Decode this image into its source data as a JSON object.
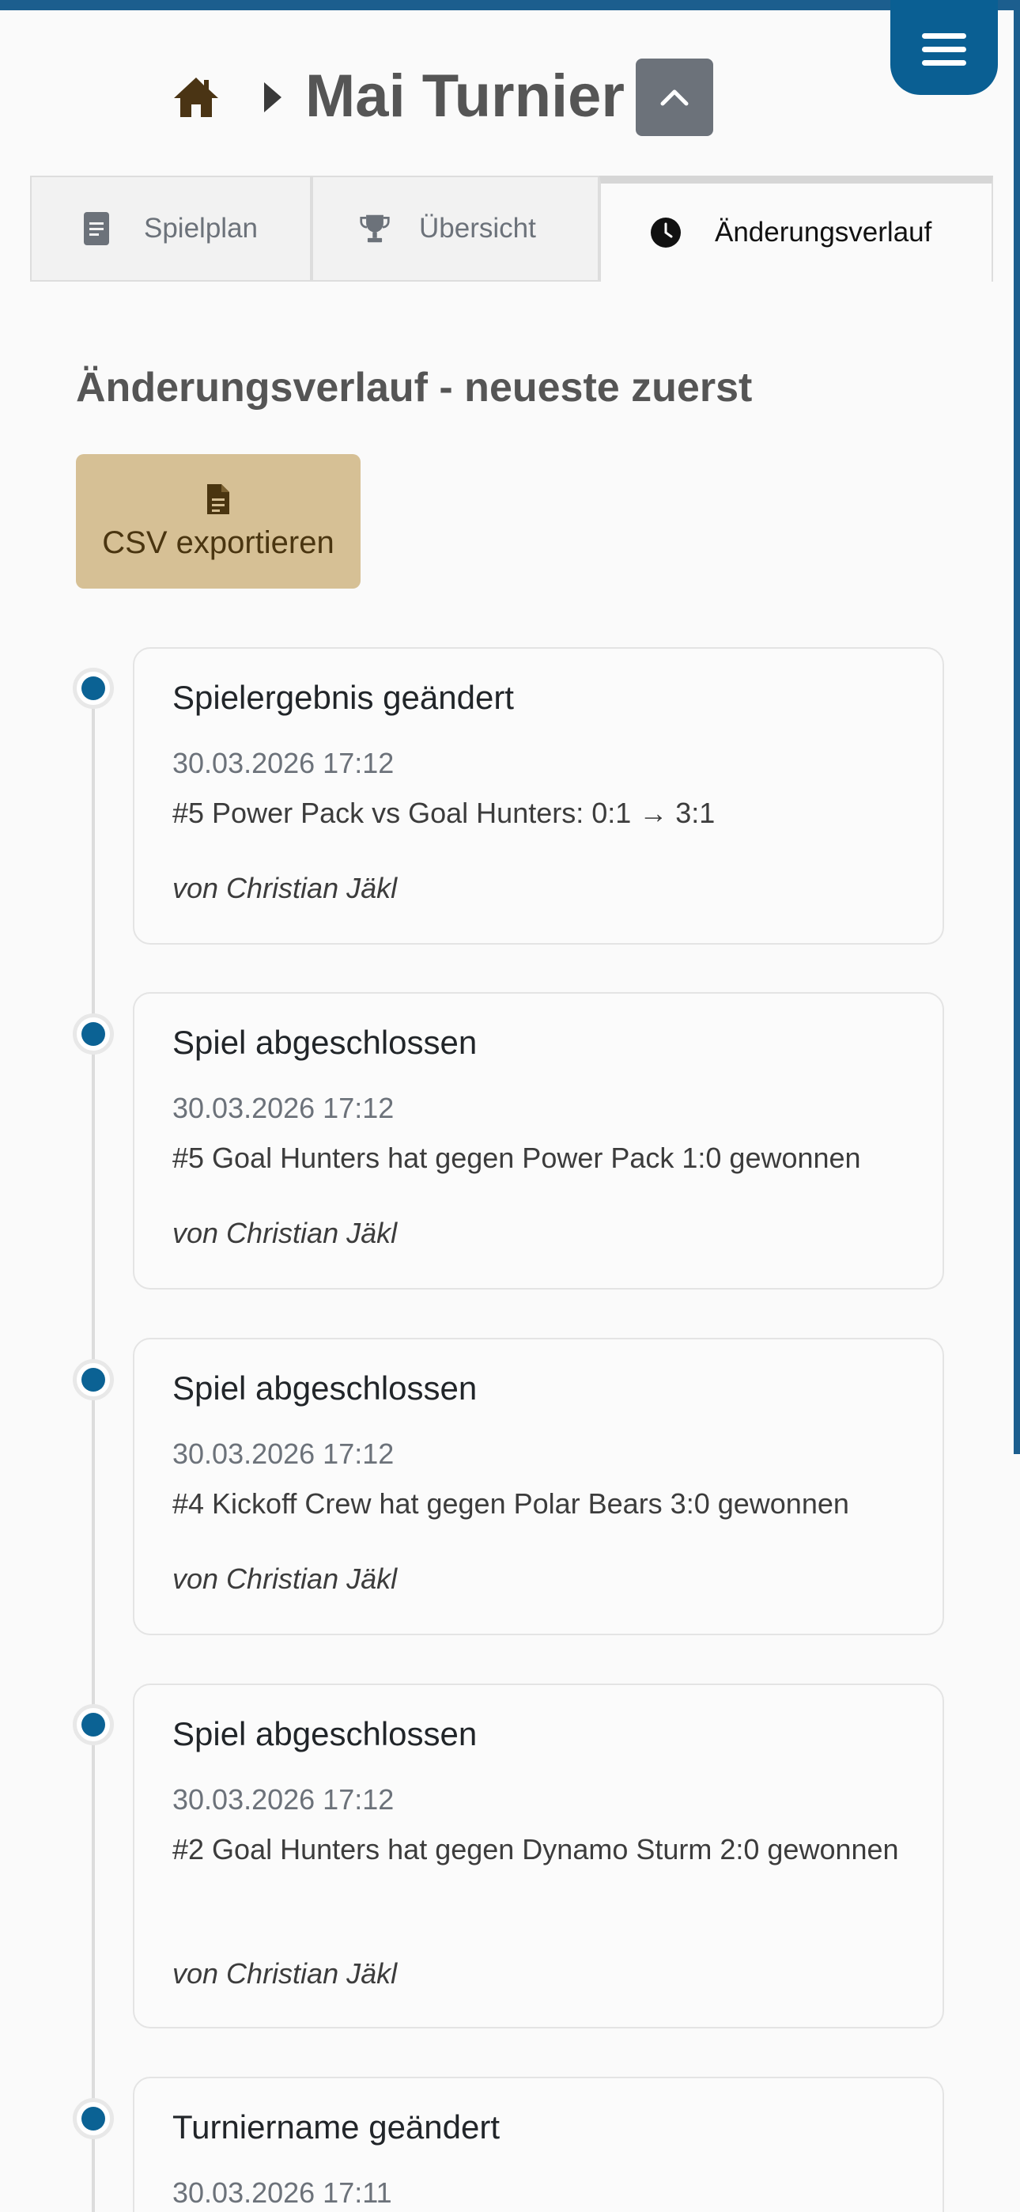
{
  "header": {
    "title": "Mai Turnier",
    "home_icon": "home-icon",
    "breadcrumb_icon": "caret-right-icon",
    "collapse_icon": "chevron-up-icon",
    "menu_icon": "hamburger-icon"
  },
  "tabs": [
    {
      "label": "Spielplan",
      "icon": "document-icon",
      "active": false
    },
    {
      "label": "Übersicht",
      "icon": "trophy-icon",
      "active": false
    },
    {
      "label": "Änderungsverlauf",
      "icon": "clock-icon",
      "active": true
    }
  ],
  "history": {
    "heading": "Änderungsverlauf - neueste zuerst",
    "export_label": "CSV exportieren",
    "export_icon": "file-icon",
    "entries": [
      {
        "title": "Spielergebnis geändert",
        "time": "30.03.2026 17:12",
        "description": "#5 Power Pack vs Goal Hunters: 0:1 → 3:1",
        "author": "von Christian Jäkl"
      },
      {
        "title": "Spiel abgeschlossen",
        "time": "30.03.2026 17:12",
        "description": "#5 Goal Hunters hat gegen Power Pack 1:0 gewonnen",
        "author": "von Christian Jäkl"
      },
      {
        "title": "Spiel abgeschlossen",
        "time": "30.03.2026 17:12",
        "description": "#4 Kickoff Crew hat gegen Polar Bears 3:0 gewonnen",
        "author": "von Christian Jäkl"
      },
      {
        "title": "Spiel abgeschlossen",
        "time": "30.03.2026 17:12",
        "description": "#2 Goal Hunters hat gegen Dynamo Sturm 2:0 gewonnen",
        "author": "von Christian Jäkl"
      },
      {
        "title": "Turniername geändert",
        "time": "30.03.2026 17:11",
        "description": "",
        "author": ""
      }
    ]
  },
  "colors": {
    "primary": "#0b6294",
    "export_button": "#d6c095",
    "collapse_button": "#6c727a"
  }
}
